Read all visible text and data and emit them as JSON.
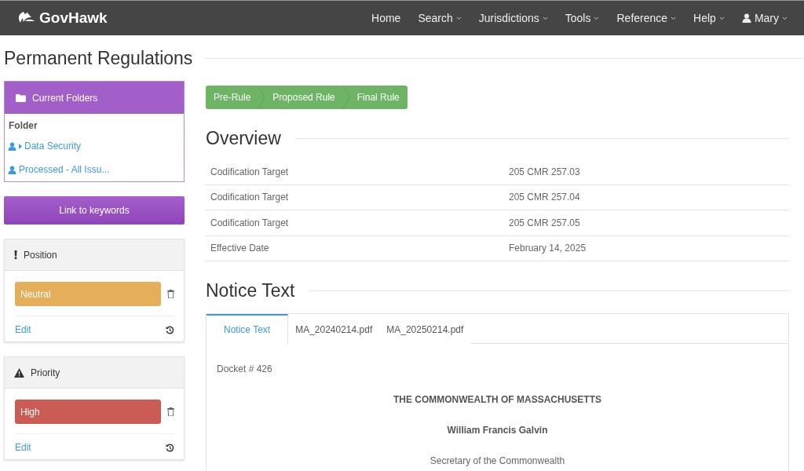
{
  "navbar": {
    "brand": "GovHawk",
    "items": [
      {
        "label": "Home",
        "has_menu": false,
        "kind": "link"
      },
      {
        "label": "Search",
        "has_menu": true,
        "kind": "link"
      },
      {
        "label": "Jurisdictions",
        "has_menu": true,
        "kind": "link"
      },
      {
        "label": "Tools",
        "has_menu": true,
        "kind": "link"
      },
      {
        "label": "Reference",
        "has_menu": true,
        "kind": "link"
      },
      {
        "label": "Help",
        "has_menu": true,
        "kind": "link"
      },
      {
        "label": "Mary",
        "has_menu": true,
        "kind": "user"
      }
    ]
  },
  "page_title": "Permanent Regulations",
  "folders": {
    "title": "Current Folders",
    "heading": "Folder",
    "items": [
      {
        "label": "Data Security",
        "kind": "group"
      },
      {
        "label": "Processed - All Issu...",
        "kind": "leaf"
      }
    ]
  },
  "keywords_button": "Link to keywords",
  "panels": [
    {
      "title": "Position",
      "kind": "position",
      "tag": {
        "label": "Neutral",
        "color": "#e4ae5a"
      },
      "edit": "Edit"
    },
    {
      "title": "Priority",
      "kind": "priority",
      "tag": {
        "label": "High",
        "color": "#cb5c55"
      },
      "edit": "Edit"
    }
  ],
  "stages": [
    "Pre-Rule",
    "Proposed Rule",
    "Final Rule"
  ],
  "overview": {
    "title": "Overview",
    "rows": [
      {
        "label": "Codification Target",
        "value": "205 CMR 257.03"
      },
      {
        "label": "Codification Target",
        "value": "205 CMR 257.04"
      },
      {
        "label": "Codification Target",
        "value": "205 CMR 257.05"
      },
      {
        "label": "Effective Date",
        "value": "February 14, 2025"
      }
    ]
  },
  "notice": {
    "title": "Notice Text",
    "tabs": [
      {
        "label": "Notice Text",
        "selected": true
      },
      {
        "label": "MA_20240214.pdf",
        "selected": false
      },
      {
        "label": "MA_20250214.pdf",
        "selected": false
      }
    ],
    "docket": "Docket # 426",
    "lines": [
      {
        "text": "THE COMMONWEALTH OF MASSACHUSETTS",
        "bold": true
      },
      {
        "text": "William Francis Galvin",
        "bold": true
      },
      {
        "text": "Secretary of the Commonwealth",
        "bold": false
      }
    ]
  }
}
